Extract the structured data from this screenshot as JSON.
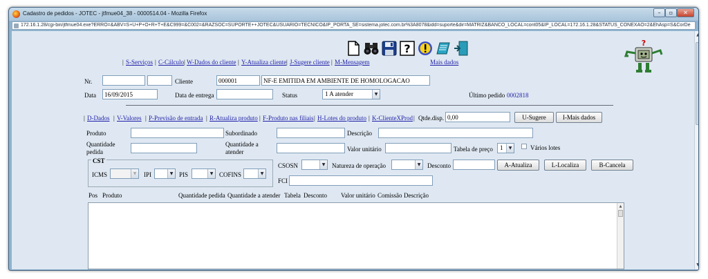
{
  "window": {
    "title": "Cadastro de pedidos - JOTEC - jtfmue04_38 - 0000514.04 - Mozilla Firefox",
    "url": "172.16.1.28/cgi-bin/jtfmue04.exe?ERRO=&ABV=S+U+P+O+R+T+E&C999=&C002=&RAZSOC=SUPORTE++JOTEC&USUARIO=TECNICO&IP_PORTA_SE=sistema.jotec.com.br%3A8078&idd=suporte&dir=MATRIZ&BANCO_LOCAL=cont05&IP_LOCAL=172.16.1.28&STATUS_CONEXAO=2&EhAsp=S&CorDe"
  },
  "toolbar": {
    "icons": [
      "new-document-icon",
      "binoculars-icon",
      "save-disk-icon",
      "help-icon",
      "exclamation-icon",
      "notes-icon",
      "exit-door-icon"
    ]
  },
  "nav1": {
    "servicos": "S-Serviços",
    "calculo": "C-Cálculo",
    "dados_cliente": "W-Dados do cliente",
    "atualiza_cliente": "Y-Atualiza cliente",
    "sugere_cliente": "J-Sugere cliente",
    "mensagem": "M-Mensagem",
    "mais_dados": "Mais dados"
  },
  "header": {
    "nr_label": "Nr.",
    "nr_value": "",
    "nr_value2": "",
    "cliente_label": "Cliente",
    "cliente_code": "000001",
    "cliente_name": "NF-E EMITIDA EM AMBIENTE DE HOMOLOGACAO",
    "data_label": "Data",
    "data_value": "16/09/2015",
    "entrega_label": "Data de entrega",
    "entrega_value": "",
    "status_label": "Status",
    "status_value": "1 A atender",
    "ultimo_label": "Último pedido",
    "ultimo_value": "0002818"
  },
  "nav2": {
    "dados": "D-Dados",
    "valores": "V-Valores",
    "previsao": "P-Previsão de entrada",
    "atualiza_produto": "R-Atualiza produto",
    "produto_filiais": "F-Produto nas filiais",
    "lotes": "H-Lotes do produto",
    "cliente_xprod": "K-ClienteXProd",
    "qtde_label": "Qtde.disp.",
    "qtde_value": "0,00",
    "sugere_btn": "U-Sugere",
    "mais_dados_btn": "I-Mais dados"
  },
  "item": {
    "produto_label": "Produto",
    "subordinado_label": "Subordinado",
    "descricao_label": "Descrição",
    "quantidade_label_1": "Quantidade",
    "quantidade_label_2": "pedida",
    "qtd_atender_label_1": "Quantidade a",
    "qtd_atender_label_2": "atender",
    "valor_unitario_label": "Valor unitário",
    "tabela_label": "Tabela de preço",
    "tabela_value": "1",
    "varios_lotes_label": "Vários lotes",
    "cst_legend": "CST",
    "icms_label": "ICMS",
    "ipi_label": "IPI",
    "pis_label": "PIS",
    "cofins_label": "COFINS",
    "csosn_label": "CSOSN",
    "natureza_label": "Natureza de operação",
    "desconto_label": "Desconto",
    "fci_label": "FCI",
    "atualiza_btn": "A-Atualiza",
    "localiza_btn": "L-Localiza",
    "cancela_btn": "B-Cancela"
  },
  "list": {
    "headers": [
      "Pos",
      "Produto",
      "Quantidade pedida",
      "Quantidade a atender",
      "Tabela",
      "Desconto",
      "Valor unitário",
      "Comissão",
      "Descrição"
    ]
  }
}
